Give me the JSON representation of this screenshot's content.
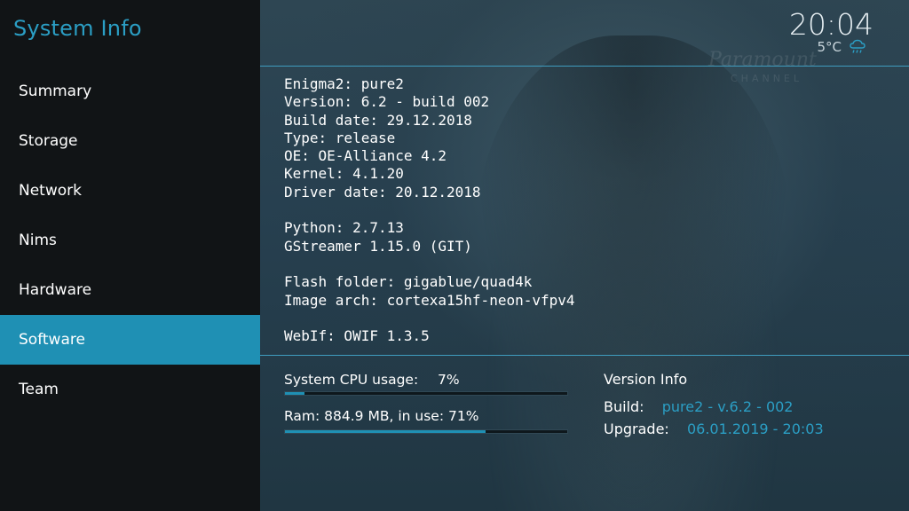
{
  "app": {
    "title": "System Info"
  },
  "sidebar": {
    "items": [
      {
        "label": "Summary"
      },
      {
        "label": "Storage"
      },
      {
        "label": "Network"
      },
      {
        "label": "Nims"
      },
      {
        "label": "Hardware"
      },
      {
        "label": "Software",
        "active": true
      },
      {
        "label": "Team"
      }
    ]
  },
  "header": {
    "time": "20:04",
    "temperature": "5°C",
    "weather_icon": "rain-cloud-icon"
  },
  "software_info": {
    "lines": [
      "Enigma2: pure2",
      "Version: 6.2 - build 002",
      "Build date: 29.12.2018",
      "Type: release",
      "OE: OE-Alliance 4.2",
      "Kernel: 4.1.20",
      "Driver date: 20.12.2018",
      "",
      "Python: 2.7.13",
      "GStreamer 1.15.0 (GIT)",
      "",
      "Flash folder: gigablue/quad4k",
      "Image arch: cortexa15hf-neon-vfpv4",
      "",
      "WebIf: OWIF 1.3.5"
    ]
  },
  "stats": {
    "cpu_label": "System CPU usage:",
    "cpu_value": "7%",
    "cpu_fraction": 0.07,
    "ram_label": "Ram: 884.9 MB, in use: 71%",
    "ram_fraction": 0.71
  },
  "version_info": {
    "title": "Version Info",
    "build_label": "Build:",
    "build_value": "pure2 - v.6.2 - 002",
    "upgrade_label": "Upgrade:",
    "upgrade_value": "06.01.2019 - 20:03"
  },
  "background": {
    "logo_text": "Paramount",
    "logo_sub": "CHANNEL"
  },
  "colors": {
    "accent": "#1f90b4",
    "accent_text": "#2b9ec4",
    "sidebar_bg": "#111416"
  }
}
